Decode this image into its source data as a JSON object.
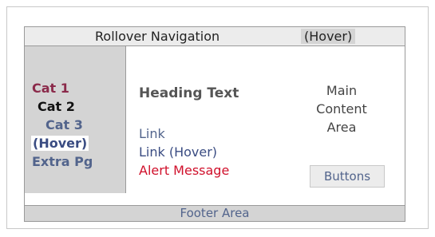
{
  "header": {
    "title": "Rollover Navigation",
    "hover_label": "(Hover)"
  },
  "sidebar": {
    "items": [
      {
        "label": "Cat 1",
        "color": "#8b2a4a"
      },
      {
        "label": "Cat 2",
        "color": "#111111"
      },
      {
        "label": "Cat 3",
        "color": "#52648c"
      },
      {
        "label": "(Hover)",
        "color": "#3a4c82"
      },
      {
        "label": "Extra Pg",
        "color": "#52648c"
      }
    ]
  },
  "content": {
    "heading": "Heading Text",
    "link": "Link",
    "link_hover": "Link (Hover)",
    "alert": "Alert Message",
    "main_area": [
      "Main",
      "Content",
      "Area"
    ],
    "button_label": "Buttons"
  },
  "footer": {
    "label": "Footer Area"
  },
  "colors": {
    "alert": "#d0102b",
    "link": "#52648c",
    "panel_gray": "#d4d4d4"
  }
}
